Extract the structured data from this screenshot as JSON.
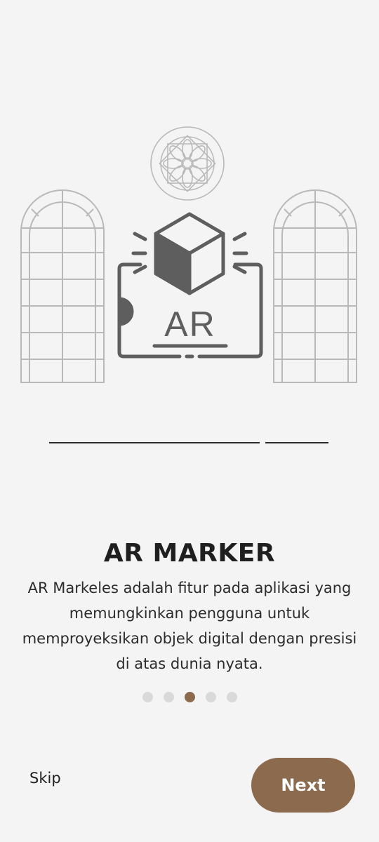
{
  "onboarding": {
    "illustration_text": "AR",
    "title": "AR MARKER",
    "description": "AR Markeles adalah fitur pada aplikasi yang memungkinkan pengguna untuk memproyeksikan objek digital dengan presisi di atas dunia nyata.",
    "page_dots": {
      "count": 5,
      "active_index": 2
    },
    "skip_label": "Skip",
    "next_label": "Next"
  },
  "colors": {
    "background": "#f4f4f4",
    "accent": "#8b6a4e",
    "dot_inactive": "#d9d9d9",
    "text": "#1f1f1f"
  },
  "icons": [
    "window-arch-icon",
    "rose-window-icon",
    "ar-cube-icon",
    "ar-marker-frame-icon"
  ]
}
